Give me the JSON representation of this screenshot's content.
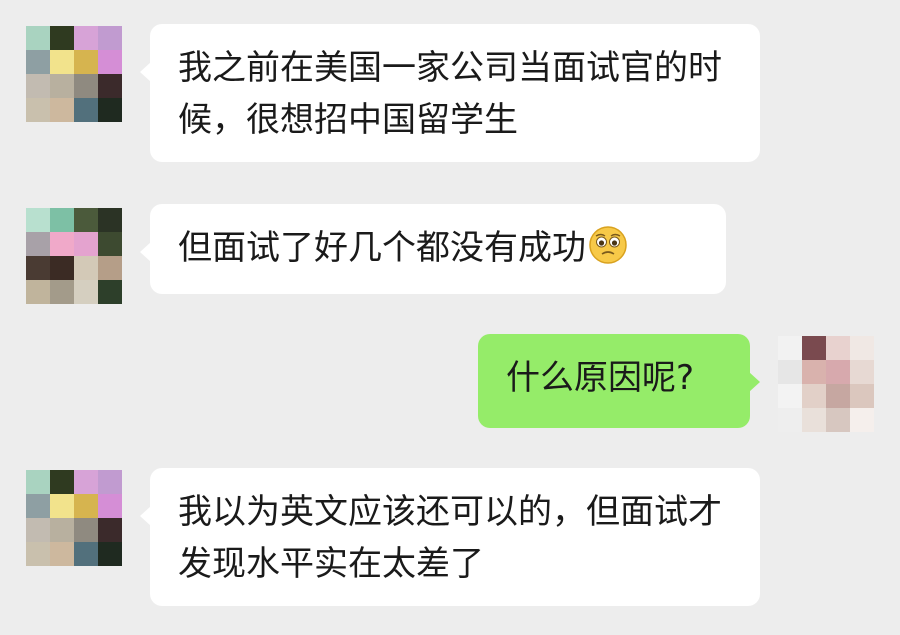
{
  "messages": [
    {
      "side": "left",
      "text": "我之前在美国一家公司当面试官的时候，很想招中国留学生"
    },
    {
      "side": "left",
      "text": "但面试了好几个都没有成功",
      "emoji": "pleading-face-icon"
    },
    {
      "side": "right",
      "text": "什么原因呢?"
    },
    {
      "side": "left",
      "text": "我以为英文应该还可以的，但面试才发现水平实在太差了"
    }
  ],
  "avatars": {
    "left_a": [
      "#a9d3c0",
      "#2f3a20",
      "#d7a3d7",
      "#c19bd0",
      "#8e9fa3",
      "#f2e38c",
      "#d6b44f",
      "#d58ed6",
      "#c2bbb1",
      "#b8b09f",
      "#8f8a80",
      "#3b2a2b",
      "#c9c0ad",
      "#cdb89e",
      "#52707c",
      "#1f2a20"
    ],
    "left_b": [
      "#b8e0cf",
      "#7dc0a5",
      "#4b5a3b",
      "#2b3325",
      "#a8a1a8",
      "#f0a9c9",
      "#e4a3cf",
      "#3d4a30",
      "#4a3b33",
      "#3b2b24",
      "#d3c9b7",
      "#b59e88",
      "#c0b49c",
      "#a39b8a",
      "#d5cfc0",
      "#2d3f2a"
    ],
    "right": [
      "#f2f2f2",
      "#7a4a4f",
      "#e8d2cf",
      "#f0e8e4",
      "#e6e6e6",
      "#d9b2ad",
      "#d7a9ad",
      "#e7d9d3",
      "#f3f3f3",
      "#e2d0c8",
      "#c6a7a1",
      "#dbc7be",
      "#eeeeee",
      "#e9e0da",
      "#d7c7c0",
      "#f5efec"
    ]
  },
  "colors": {
    "background": "#ededed",
    "incoming_bubble": "#ffffff",
    "outgoing_bubble": "#95ec69"
  }
}
